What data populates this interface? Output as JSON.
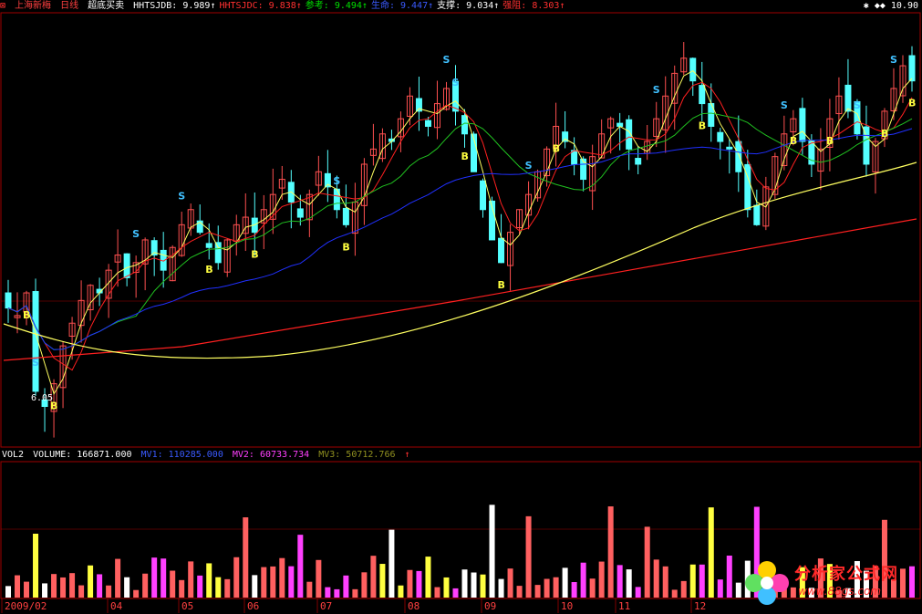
{
  "header": {
    "stock_name": "上海新梅",
    "period": "日线",
    "indicator": "超底买卖",
    "items": [
      {
        "label": "HHTSJDB: 9.989",
        "arrow": "↑",
        "color": "#ffffff"
      },
      {
        "label": "HHTSJDC: 9.838",
        "arrow": "↑",
        "color": "#ff3030"
      },
      {
        "label": "参考: 9.494",
        "arrow": "↑",
        "color": "#00e000"
      },
      {
        "label": "生命: 9.447",
        "arrow": "↑",
        "color": "#3a5aff"
      },
      {
        "label": "支撑: 9.034",
        "arrow": "↑",
        "color": "#ffffff"
      },
      {
        "label": "强阻: 8.303",
        "arrow": "↑",
        "color": "#ff3030"
      }
    ],
    "right_tools": "✱ ◆◆ 10.90"
  },
  "volume_header": {
    "name": "VOL2",
    "volume": "VOLUME: 166871.000",
    "mv1": "MV1: 110285.000",
    "mv2": "MV2: 60733.734",
    "mv3": "MV3: 50712.766",
    "arrow": "↑"
  },
  "annotations": {
    "low_label": "6.05"
  },
  "watermark": {
    "cn": "分析家公式网",
    "url": "www.88gs.com"
  },
  "colors": {
    "up": "#ff5050",
    "down": "#54ffff",
    "ma_red": "#ff2020",
    "ma_yellow": "#ffff60",
    "ma_blue": "#2030ff",
    "ma_green": "#20c020",
    "grid": "#a00000"
  },
  "chart_data": {
    "type": "candlestick",
    "x_axis_labels": [
      "2009/02",
      "04",
      "05",
      "06",
      "07",
      "08",
      "09",
      "10",
      "11",
      "12"
    ],
    "ylim": [
      5.6,
      11.3
    ],
    "low_point": 6.05,
    "close_series": [
      7.4,
      7.3,
      7.6,
      6.3,
      6.1,
      6.4,
      6.9,
      7.2,
      7.5,
      7.7,
      7.6,
      7.9,
      8.1,
      7.8,
      8.0,
      8.3,
      8.1,
      7.9,
      8.2,
      8.5,
      8.7,
      8.4,
      8.2,
      8.0,
      8.3,
      8.5,
      8.6,
      8.4,
      8.7,
      8.9,
      9.1,
      8.8,
      8.6,
      8.9,
      9.2,
      9.0,
      8.7,
      8.5,
      8.8,
      9.3,
      9.5,
      9.7,
      9.6,
      9.9,
      10.2,
      10.0,
      9.8,
      10.1,
      10.3,
      10.0,
      9.7,
      9.2,
      8.7,
      8.3,
      8.0,
      8.4,
      8.7,
      8.9,
      9.2,
      9.5,
      9.8,
      9.6,
      9.3,
      9.1,
      9.4,
      9.7,
      9.9,
      9.8,
      9.5,
      9.3,
      9.6,
      9.9,
      10.2,
      10.5,
      10.7,
      10.4,
      10.1,
      9.8,
      9.6,
      9.5,
      9.2,
      8.7,
      8.5,
      9.0,
      9.4,
      9.7,
      9.9,
      9.6,
      9.3,
      9.5,
      9.9,
      10.2,
      10.0,
      9.7,
      9.3,
      9.6,
      10.0,
      10.3,
      10.6,
      10.4
    ],
    "buy_signal_indices": [
      2,
      5,
      22,
      27,
      37,
      50,
      54,
      60,
      76,
      86,
      90,
      96,
      99
    ],
    "sell_signal_indices": [
      3,
      14,
      19,
      36,
      48,
      49,
      57,
      71,
      85,
      93,
      97
    ]
  }
}
